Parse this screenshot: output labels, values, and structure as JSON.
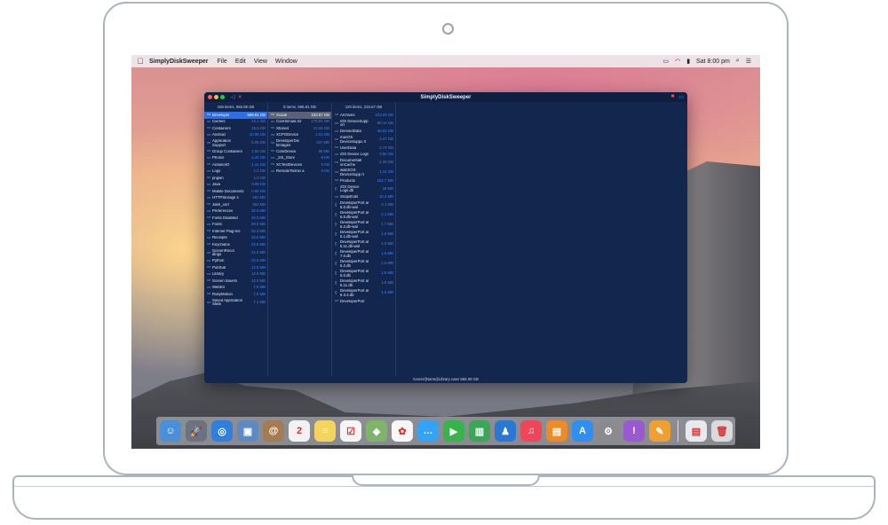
{
  "menubar": {
    "apple_icon": "apple-icon",
    "app_name": "SimplyDiskSweeper",
    "items": [
      "File",
      "Edit",
      "View",
      "Window"
    ],
    "clock": "Sat 8:00 pm"
  },
  "window": {
    "title": "SimplyDiskSweeper",
    "status": "/Users/[Name]/Library uses 565.08 GB",
    "columns": [
      {
        "header": "166 items, 565.08 GB",
        "rows": [
          {
            "name": "Developer",
            "size": "568.81 GB",
            "selected": "blue"
          },
          {
            "name": "Caches",
            "size": "12.1 GB"
          },
          {
            "name": "Containers",
            "size": "15.5 GB"
          },
          {
            "name": "Android",
            "size": "20.96 GB"
          },
          {
            "name": "Application Support",
            "size": "5.05 GB"
          },
          {
            "name": "Group Containers",
            "size": "2.55 GB"
          },
          {
            "name": "Photos",
            "size": "1.45 GB"
          },
          {
            "name": "ArduinoIO",
            "size": "1.41 GB"
          },
          {
            "name": "Logs",
            "size": "1.0 GB"
          },
          {
            "name": "pngwn",
            "size": "1.0 GB"
          },
          {
            "name": "Java",
            "size": "0.98 GB"
          },
          {
            "name": "Mobile Documents",
            "size": "0.98 GB"
          },
          {
            "name": "HTTPStorage s",
            "size": "481 MB"
          },
          {
            "name": "Jdeh_cert",
            "size": "362 MB"
          },
          {
            "name": "Preferences",
            "size": "32.5 MB"
          },
          {
            "name": "Fonts Disabled",
            "size": "32.5 MB"
          },
          {
            "name": "Fonts",
            "size": "28.5 MB"
          },
          {
            "name": "Internet Plug-Ins",
            "size": "26.3 MB"
          },
          {
            "name": "Receipts",
            "size": "22.5 MB"
          },
          {
            "name": "Keychains",
            "size": "22.5 MB"
          },
          {
            "name": "ScreenRecor dings",
            "size": "22.5 MB"
          },
          {
            "name": "Python",
            "size": "22.5 MB"
          },
          {
            "name": "PubSub",
            "size": "12.5 MB"
          },
          {
            "name": "Library",
            "size": "12.5 MB"
          },
          {
            "name": "Screen Savers",
            "size": "12.5 MB"
          },
          {
            "name": "WebKit",
            "size": "7.5 MB"
          },
          {
            "name": "RubyMotion",
            "size": "7.5 MB"
          },
          {
            "name": "Saved Application State",
            "size": "7.1 MB"
          }
        ]
      },
      {
        "header": "8 items, 568.81 GB",
        "rows": [
          {
            "name": "Xcode",
            "size": "233.67 GB",
            "selected": "grey"
          },
          {
            "name": "CoreSimula tor",
            "size": "175.94 GB"
          },
          {
            "name": "Shared",
            "size": "12.06 GB"
          },
          {
            "name": "XCPGDevice",
            "size": "1.01 GB"
          },
          {
            "name": "DeveloperDis kImages",
            "size": "237 MB"
          },
          {
            "name": "CoreDevice",
            "size": "98 MB"
          },
          {
            "name": "_DS_Store",
            "size": "8 KB"
          },
          {
            "name": "XCTestDevices",
            "size": "0 KB"
          },
          {
            "name": "RemoteTarmin a",
            "size": "0 KB"
          }
        ]
      },
      {
        "header": "120 items, 233.67 GB",
        "rows": [
          {
            "name": "Archives",
            "size": "223.09 GB"
          },
          {
            "name": "iOS DeviceSupp ort",
            "size": "80.14 GB"
          },
          {
            "name": "DerivedData",
            "size": "46.91 GB"
          },
          {
            "name": "macOS DeviceSuppo rt",
            "size": "3.47 GB"
          },
          {
            "name": "UserData",
            "size": "2.74 GB"
          },
          {
            "name": "iOS Device Logs",
            "size": "2.56 GB"
          },
          {
            "name": "DocumentatI onCache",
            "size": "2.35 GB"
          },
          {
            "name": "watchOS DeviceSupp rt",
            "size": "1.14 GB"
          },
          {
            "name": "Products",
            "size": "161.7 MB"
          },
          {
            "name": "iOS Device Logs.db",
            "size": "28 MB"
          },
          {
            "name": "Snapshots",
            "size": "10.4 MB"
          },
          {
            "name": "DeveloperPort al 5.0.db-wal",
            "size": "3.1 MB"
          },
          {
            "name": "DeveloperPort al 6.0.db-wal",
            "size": "2.1 MB"
          },
          {
            "name": "DeveloperPort al 6.2.db-wal",
            "size": "1.7 MB"
          },
          {
            "name": "DeveloperPort al 5.1.db-wal",
            "size": "1.5 MB"
          },
          {
            "name": "DeveloperPort al 5.11.db-wal",
            "size": "1.5 MB"
          },
          {
            "name": "DeveloperPort al 7.0.db",
            "size": "1.5 MB"
          },
          {
            "name": "DeveloperPort al 6.2.db",
            "size": "1.5 MB"
          },
          {
            "name": "DeveloperPort al 6.0.db",
            "size": "1.5 MB"
          },
          {
            "name": "DeveloperPort al 5.11.db",
            "size": "1.5 MB"
          },
          {
            "name": "DeveloperPort al 6.3.3.db",
            "size": "1.5 MB"
          },
          {
            "name": "DeveloperPort",
            "size": ""
          }
        ]
      }
    ]
  },
  "dock": {
    "apps": [
      {
        "name": "finder",
        "color": "#4a90d9",
        "glyph": "☺"
      },
      {
        "name": "launchpad",
        "color": "#6b7280",
        "glyph": "🚀"
      },
      {
        "name": "safari",
        "color": "#2f7fe0",
        "glyph": "◎"
      },
      {
        "name": "preview",
        "color": "#5d8ac0",
        "glyph": "▣"
      },
      {
        "name": "contacts",
        "color": "#a57b52",
        "glyph": "@"
      },
      {
        "name": "calendar",
        "color": "#f2f2f2",
        "glyph": "2"
      },
      {
        "name": "notes",
        "color": "#f4d35e",
        "glyph": "≡"
      },
      {
        "name": "reminders",
        "color": "#f5f5f5",
        "glyph": "☑"
      },
      {
        "name": "maps",
        "color": "#7fb46b",
        "glyph": "◈"
      },
      {
        "name": "photos",
        "color": "#f7f7f7",
        "glyph": "✿"
      },
      {
        "name": "messages",
        "color": "#34a3f7",
        "glyph": "…"
      },
      {
        "name": "facetime",
        "color": "#37b34a",
        "glyph": "▶"
      },
      {
        "name": "numbers",
        "color": "#3aa657",
        "glyph": "▥"
      },
      {
        "name": "keynote",
        "color": "#2a78d6",
        "glyph": "♟"
      },
      {
        "name": "music",
        "color": "#f0465a",
        "glyph": "♫"
      },
      {
        "name": "books",
        "color": "#f08a24",
        "glyph": "▤"
      },
      {
        "name": "app-store",
        "color": "#2e8ff0",
        "glyph": "A"
      },
      {
        "name": "system-preferences",
        "color": "#8a8a8f",
        "glyph": "⚙"
      },
      {
        "name": "itunes-purple",
        "color": "#9b59d0",
        "glyph": "!"
      },
      {
        "name": "instruments",
        "color": "#f0a030",
        "glyph": "✎"
      }
    ],
    "documents": [
      {
        "name": "document",
        "color": "#e8e8ee",
        "glyph": "▤"
      },
      {
        "name": "trash",
        "color": "#d8dade",
        "glyph": "🗑"
      }
    ]
  }
}
